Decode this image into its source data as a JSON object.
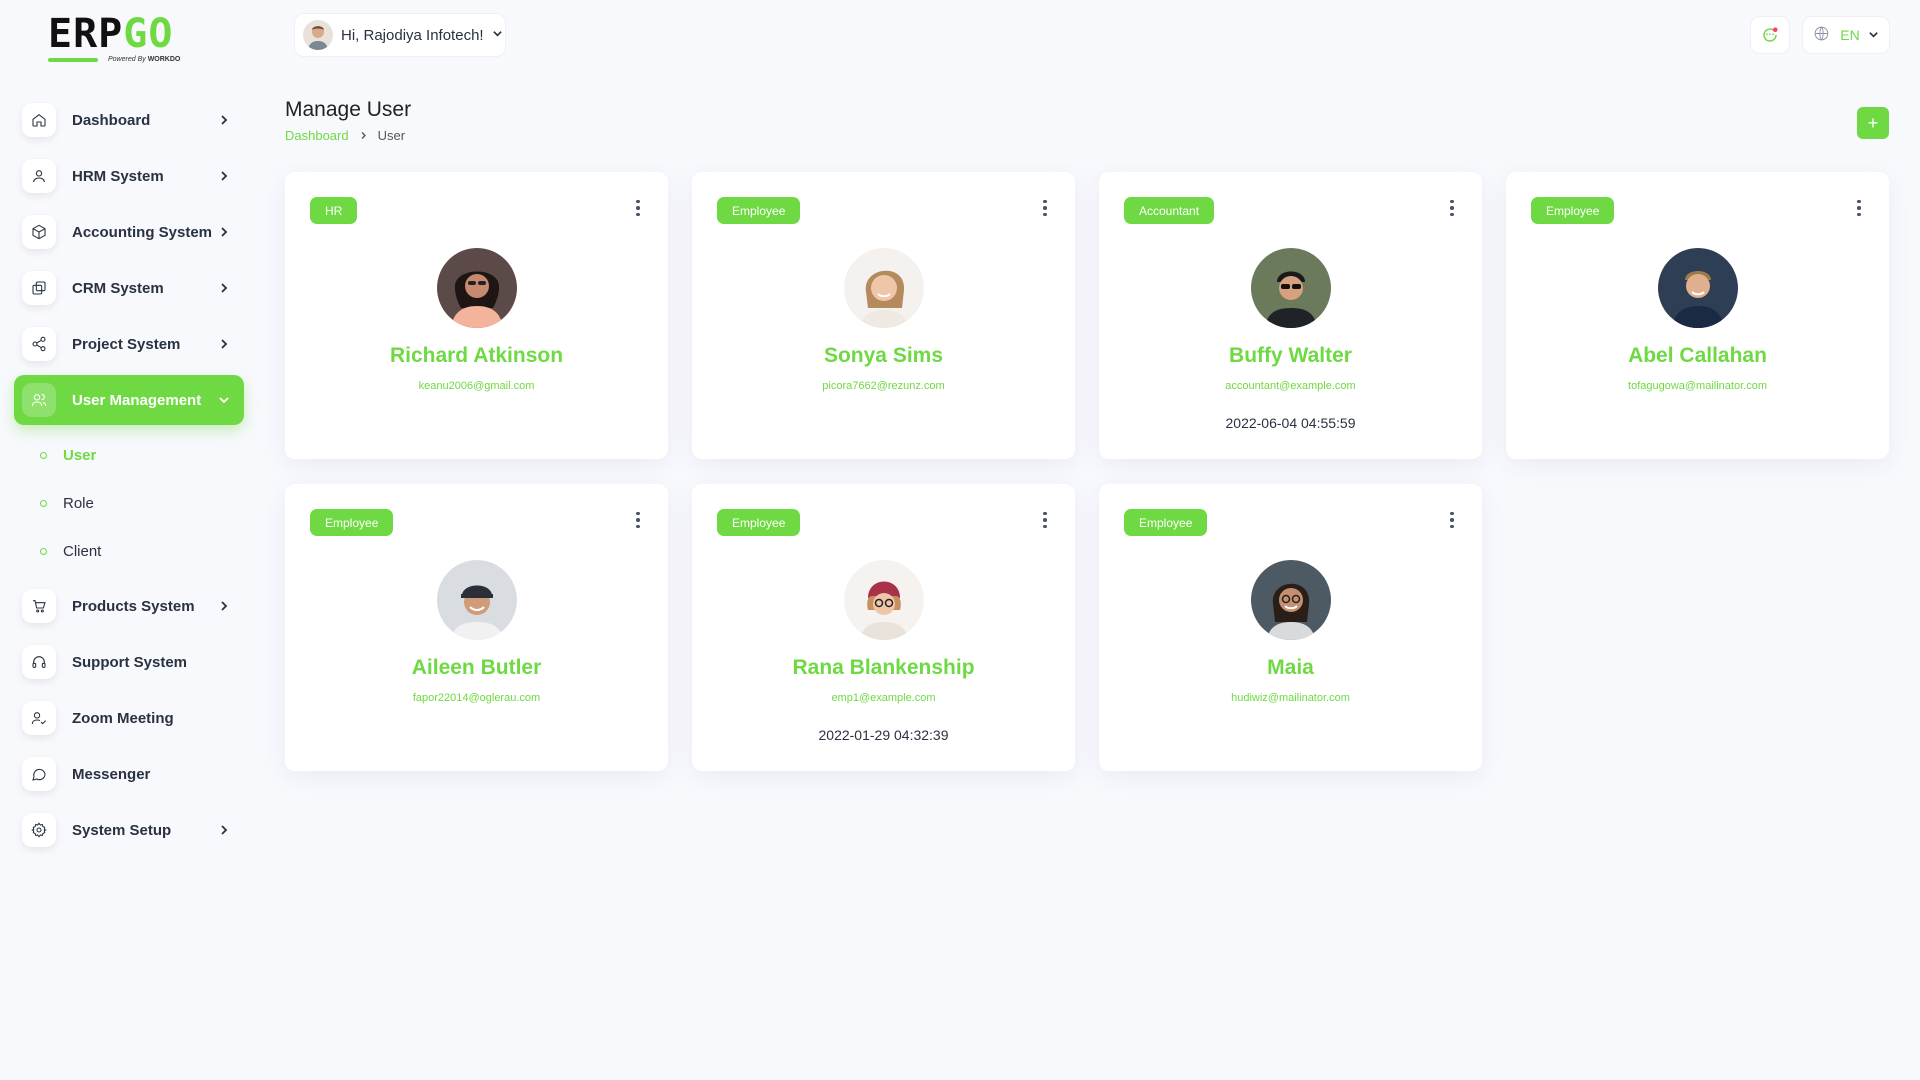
{
  "logo": {
    "brand_left": "ERP",
    "brand_right": "GO",
    "powered_by": "Powered By",
    "powered_brand": "WORKDO"
  },
  "topbar": {
    "greeting": "Hi, Rajodiya Infotech!",
    "language": "EN"
  },
  "sidebar": {
    "items": [
      {
        "label": "Dashboard",
        "icon": "home-icon",
        "chevron": true
      },
      {
        "label": "HRM System",
        "icon": "user-icon",
        "chevron": true
      },
      {
        "label": "Accounting System",
        "icon": "box-icon",
        "chevron": true
      },
      {
        "label": "CRM System",
        "icon": "layers-icon",
        "chevron": true
      },
      {
        "label": "Project System",
        "icon": "share-icon",
        "chevron": true
      },
      {
        "label": "User Management",
        "icon": "users-icon",
        "chevron": true,
        "active": true
      },
      {
        "label": "Products System",
        "icon": "cart-icon",
        "chevron": true
      },
      {
        "label": "Support System",
        "icon": "headphones-icon",
        "chevron": false
      },
      {
        "label": "Zoom Meeting",
        "icon": "user-check-icon",
        "chevron": false
      },
      {
        "label": "Messenger",
        "icon": "message-icon",
        "chevron": false
      },
      {
        "label": "System Setup",
        "icon": "gear-icon",
        "chevron": true
      }
    ],
    "submenu": [
      {
        "label": "User",
        "active": true
      },
      {
        "label": "Role"
      },
      {
        "label": "Client"
      }
    ]
  },
  "page": {
    "title": "Manage User",
    "breadcrumb": [
      "Dashboard",
      "User"
    ],
    "add_button": "+"
  },
  "users": [
    {
      "role": "HR",
      "name": "Richard Atkinson",
      "email": "keanu2006@gmail.com",
      "date": ""
    },
    {
      "role": "Employee",
      "name": "Sonya Sims",
      "email": "picora7662@rezunz.com",
      "date": ""
    },
    {
      "role": "Accountant",
      "name": "Buffy Walter",
      "email": "accountant@example.com",
      "date": "2022-06-04 04:55:59"
    },
    {
      "role": "Employee",
      "name": "Abel Callahan",
      "email": "tofagugowa@mailinator.com",
      "date": ""
    },
    {
      "role": "Employee",
      "name": "Aileen Butler",
      "email": "fapor22014@oglerau.com",
      "date": ""
    },
    {
      "role": "Employee",
      "name": "Rana Blankenship",
      "email": "emp1@example.com",
      "date": "2022-01-29 04:32:39"
    },
    {
      "role": "Employee",
      "name": "Maia",
      "email": "hudiwiz@mailinator.com",
      "date": ""
    }
  ],
  "colors": {
    "accent": "#6fd943",
    "text": "#293240",
    "background": "#f8f9fd"
  }
}
